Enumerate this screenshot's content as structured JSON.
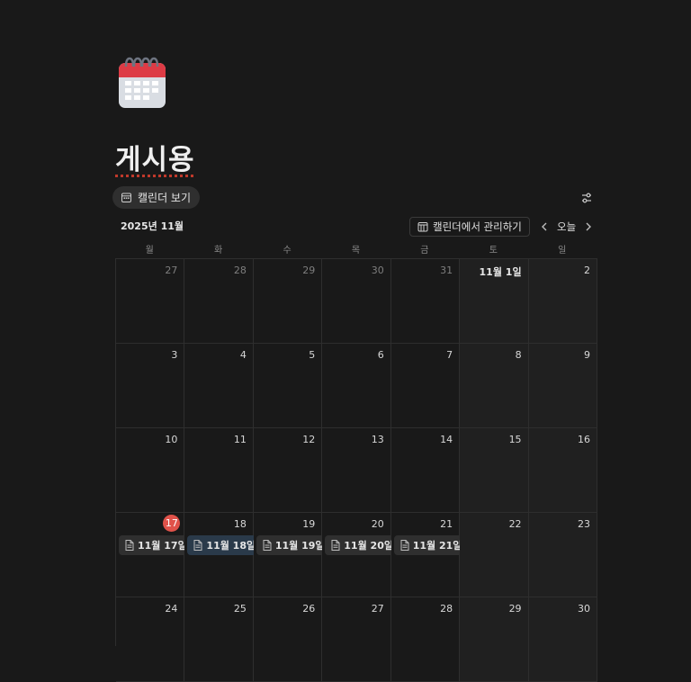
{
  "page": {
    "icon": "calendar-icon",
    "title": "게시용"
  },
  "view": {
    "label": "캘린더 보기",
    "icon": "calendar-view-icon"
  },
  "toolbar": {
    "month": "2025년 11월",
    "manage_label": "캘린더에서 관리하기",
    "today_label": "오늘"
  },
  "weekdays": [
    "월",
    "화",
    "수",
    "목",
    "금",
    "토",
    "일"
  ],
  "days": [
    {
      "num": "27",
      "muted": true
    },
    {
      "num": "28",
      "muted": true
    },
    {
      "num": "29",
      "muted": true
    },
    {
      "num": "30",
      "muted": true
    },
    {
      "num": "31",
      "muted": true
    },
    {
      "num": "11월 1일",
      "first": true
    },
    {
      "num": "2"
    },
    {
      "num": "3"
    },
    {
      "num": "4"
    },
    {
      "num": "5"
    },
    {
      "num": "6"
    },
    {
      "num": "7"
    },
    {
      "num": "8"
    },
    {
      "num": "9"
    },
    {
      "num": "10"
    },
    {
      "num": "11"
    },
    {
      "num": "12"
    },
    {
      "num": "13"
    },
    {
      "num": "14"
    },
    {
      "num": "15"
    },
    {
      "num": "16"
    },
    {
      "num": "17",
      "today": true,
      "event": "11월 17일"
    },
    {
      "num": "18",
      "event": "11월 18일",
      "selected": true
    },
    {
      "num": "19",
      "event": "11월 19일"
    },
    {
      "num": "20",
      "event": "11월 20일"
    },
    {
      "num": "21",
      "event": "11월 21일"
    },
    {
      "num": "22"
    },
    {
      "num": "23"
    },
    {
      "num": "24"
    },
    {
      "num": "25"
    },
    {
      "num": "26"
    },
    {
      "num": "27"
    },
    {
      "num": "28"
    },
    {
      "num": "29"
    },
    {
      "num": "30"
    }
  ],
  "colors": {
    "background": "#191919",
    "today": "#e0524a",
    "selected_event": "#2a3a4a"
  }
}
